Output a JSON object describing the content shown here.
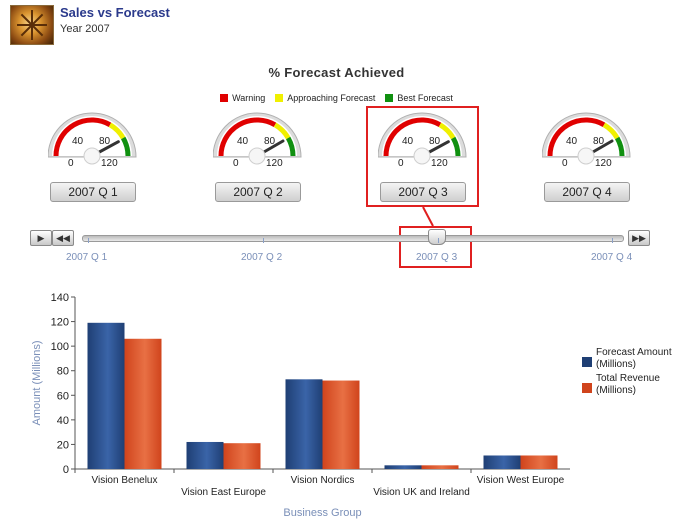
{
  "header": {
    "title": "Sales vs Forecast",
    "subtitle": "Year 2007"
  },
  "gauges": {
    "title": "% Forecast Achieved",
    "legend": [
      {
        "label": "Warning",
        "color": "#e00000"
      },
      {
        "label": "Approaching Forecast",
        "color": "#f0f000"
      },
      {
        "label": "Best Forecast",
        "color": "#109010"
      }
    ],
    "dial_labels": {
      "zero": "0",
      "forty": "40",
      "eighty": "80",
      "max": "120"
    },
    "items": [
      {
        "quarter": "2007 Q 1",
        "value": 101
      },
      {
        "quarter": "2007 Q 2",
        "value": 100
      },
      {
        "quarter": "2007 Q 3",
        "value": 101
      },
      {
        "quarter": "2007 Q 4",
        "value": 100
      }
    ],
    "selected": "2007 Q 3"
  },
  "slider": {
    "play_icon": "play-icon",
    "rewind_icon": "rewind-icon",
    "forward_icon": "fast-forward-icon",
    "ticks": [
      "2007 Q 1",
      "2007 Q 2",
      "2007 Q 3",
      "2007 Q 4"
    ],
    "selected_index": 2
  },
  "chart_data": {
    "type": "bar",
    "title": "",
    "xlabel": "Business Group",
    "ylabel": "Amount (Millions)",
    "ylim": [
      0,
      140
    ],
    "yticks": [
      0,
      20,
      40,
      60,
      80,
      100,
      120,
      140
    ],
    "categories": [
      "Vision Benelux",
      "Vision East Europe",
      "Vision Nordics",
      "Vision UK and Ireland",
      "Vision West Europe"
    ],
    "series": [
      {
        "name": "Forecast Amount (Millions)",
        "color": "#1f3f74",
        "values": [
          119,
          22,
          73,
          3,
          11
        ]
      },
      {
        "name": "Total Revenue (Millions)",
        "color": "#d0441c",
        "values": [
          106,
          21,
          72,
          3,
          11
        ]
      }
    ],
    "legend_position": "right",
    "grid": false
  }
}
